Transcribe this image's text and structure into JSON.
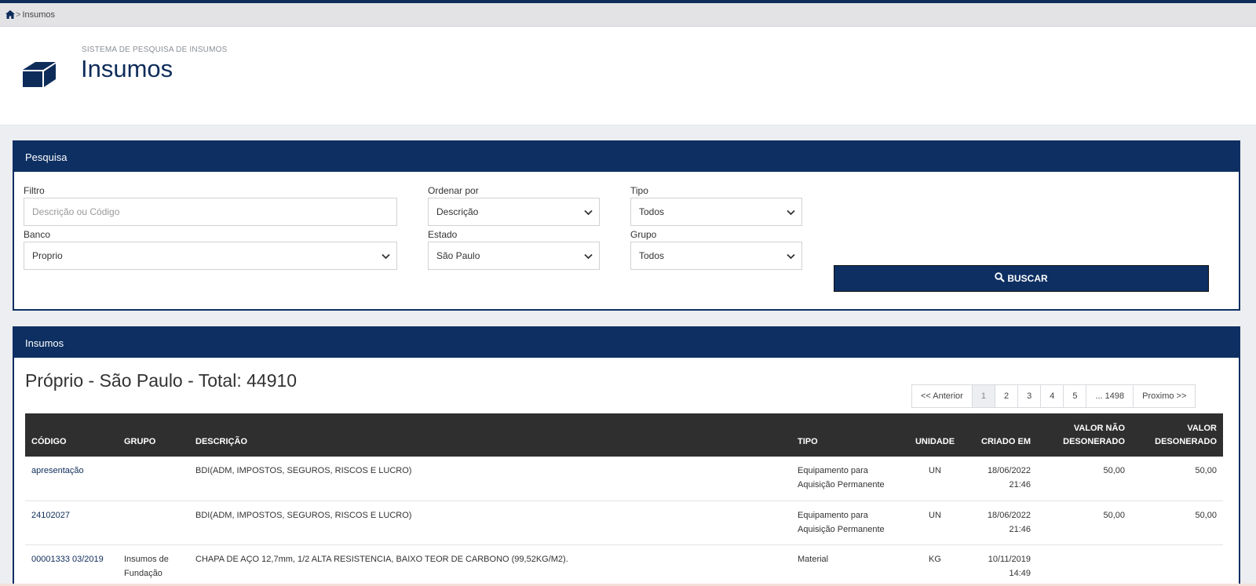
{
  "breadcrumb": {
    "home_icon": "home-icon",
    "separator": ">",
    "current": "Insumos"
  },
  "header": {
    "subtitle": "SISTEMA DE PESQUISA DE INSUMOS",
    "title": "Insumos",
    "icon": "cube-icon"
  },
  "search": {
    "panel_title": "Pesquisa",
    "filtro": {
      "label": "Filtro",
      "placeholder": "Descrição ou Código"
    },
    "ordenar": {
      "label": "Ordenar por",
      "value": "Descrição"
    },
    "tipo": {
      "label": "Tipo",
      "value": "Todos"
    },
    "banco": {
      "label": "Banco",
      "value": "Proprio"
    },
    "estado": {
      "label": "Estado",
      "value": "São Paulo"
    },
    "grupo": {
      "label": "Grupo",
      "value": "Todos"
    },
    "button": "BUSCAR"
  },
  "results": {
    "panel_title": "Insumos",
    "heading": "Próprio - São Paulo - Total: 44910",
    "pager": [
      "<< Anterior",
      "1",
      "2",
      "3",
      "4",
      "5",
      "... 1498",
      "Proximo >>"
    ],
    "pager_active": "1",
    "columns": {
      "codigo": "CÓDIGO",
      "grupo": "GRUPO",
      "descricao": "DESCRIÇÃO",
      "tipo": "TIPO",
      "unidade": "UNIDADE",
      "criado": "CRIADO EM",
      "nd1": "VALOR NÃO",
      "nd2": "DESONERADO",
      "d1": "VALOR",
      "d2": "DESONERADO"
    },
    "rows": [
      {
        "codigo": "apresentação",
        "grupo1": "",
        "grupo2": "",
        "descricao": "BDI(ADM, IMPOSTOS, SEGUROS, RISCOS E LUCRO)",
        "tipo1": "Equipamento para",
        "tipo2": "Aquisição Permanente",
        "unidade": "UN",
        "data": "18/06/2022",
        "hora": "21:46",
        "nao_desonerado": "50,00",
        "desonerado": "50,00"
      },
      {
        "codigo": "24102027",
        "grupo1": "",
        "grupo2": "",
        "descricao": "BDI(ADM, IMPOSTOS, SEGUROS, RISCOS E LUCRO)",
        "tipo1": "Equipamento para",
        "tipo2": "Aquisição Permanente",
        "unidade": "UN",
        "data": "18/06/2022",
        "hora": "21:46",
        "nao_desonerado": "50,00",
        "desonerado": "50,00"
      },
      {
        "codigo": "00001333 03/2019",
        "grupo1": "Insumos de",
        "grupo2": "Fundação",
        "descricao": "CHAPA DE AÇO 12,7mm, 1/2 ALTA RESISTENCIA, BAIXO TEOR DE CARBONO (99,52KG/M2).",
        "tipo1": "Material",
        "tipo2": "",
        "unidade": "KG",
        "data": "10/11/2019",
        "hora": "14:49",
        "nao_desonerado": "",
        "desonerado": ""
      }
    ]
  }
}
